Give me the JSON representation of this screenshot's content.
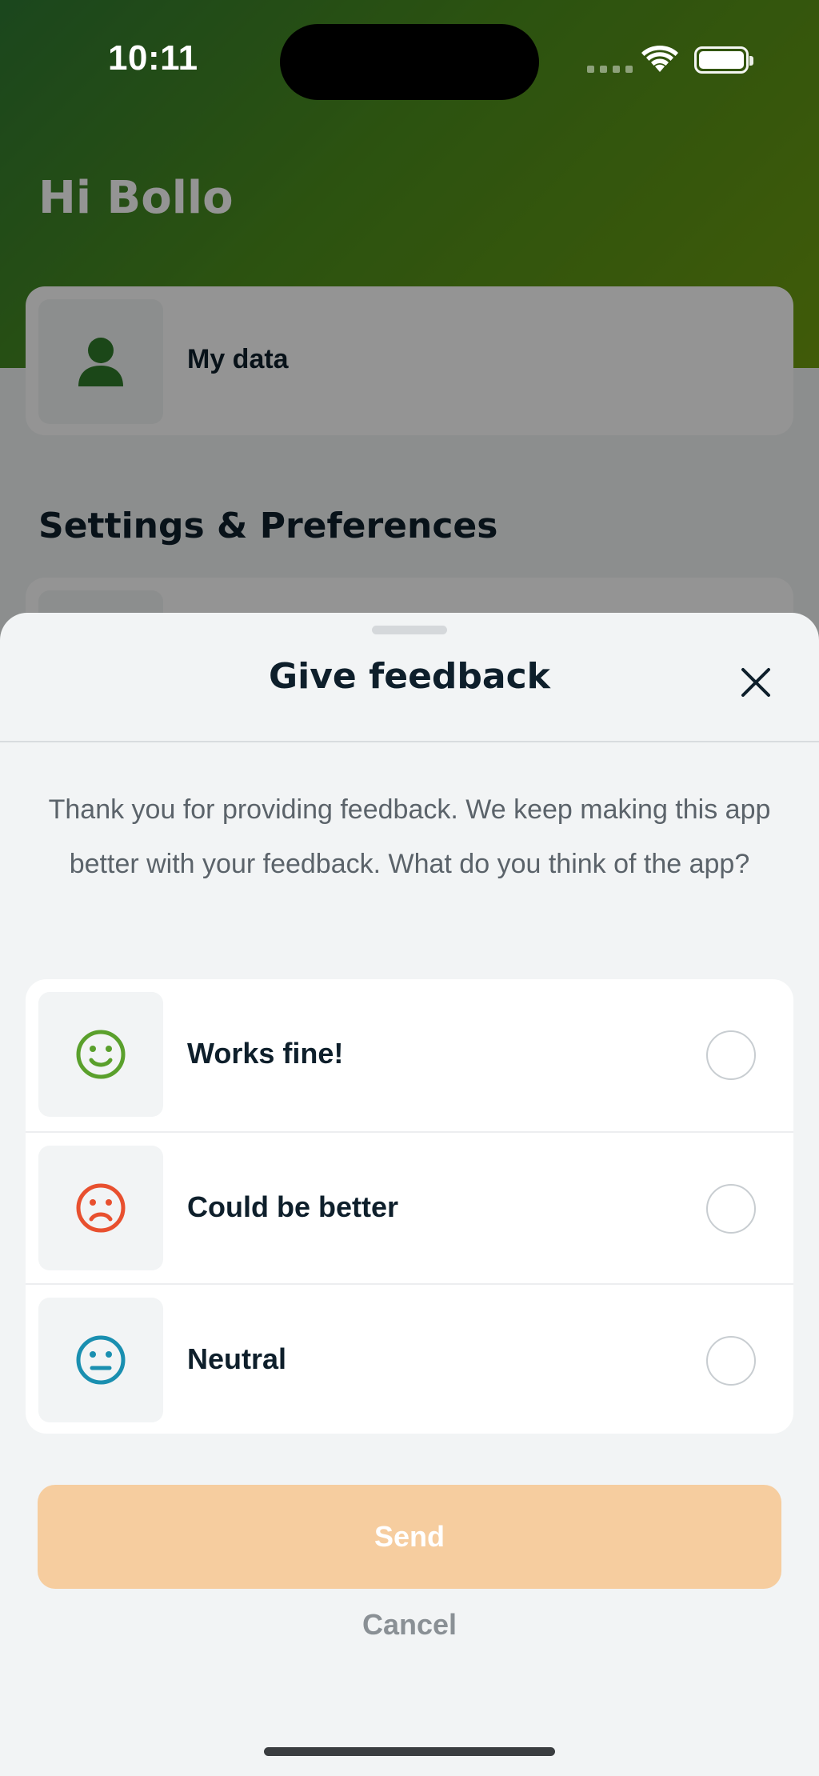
{
  "status_bar": {
    "time": "10:11",
    "icons": [
      "cellular-signal-icon",
      "wifi-icon",
      "battery-icon"
    ]
  },
  "background_screen": {
    "greeting": "Hi Bollo",
    "my_data_label": "My data",
    "my_data_icon": "person-icon",
    "section_title": "Settings & Preferences"
  },
  "sheet": {
    "title": "Give feedback",
    "close_icon": "close-icon",
    "intro": "Thank you for providing feedback. We keep making this app better with your feedback. What do you think of the app?",
    "options": [
      {
        "label": "Works fine!",
        "icon": "smile-icon",
        "color": "#5aa02c",
        "selected": false
      },
      {
        "label": "Could be better",
        "icon": "frown-icon",
        "color": "#e8502f",
        "selected": false
      },
      {
        "label": "Neutral",
        "icon": "neutral-face-icon",
        "color": "#1a8fb0",
        "selected": false
      }
    ],
    "send_label": "Send",
    "cancel_label": "Cancel"
  },
  "colors": {
    "brand_green": "#4d8f1c",
    "send_disabled": "#f6cd9f",
    "text_dark": "#0e1f2b"
  }
}
